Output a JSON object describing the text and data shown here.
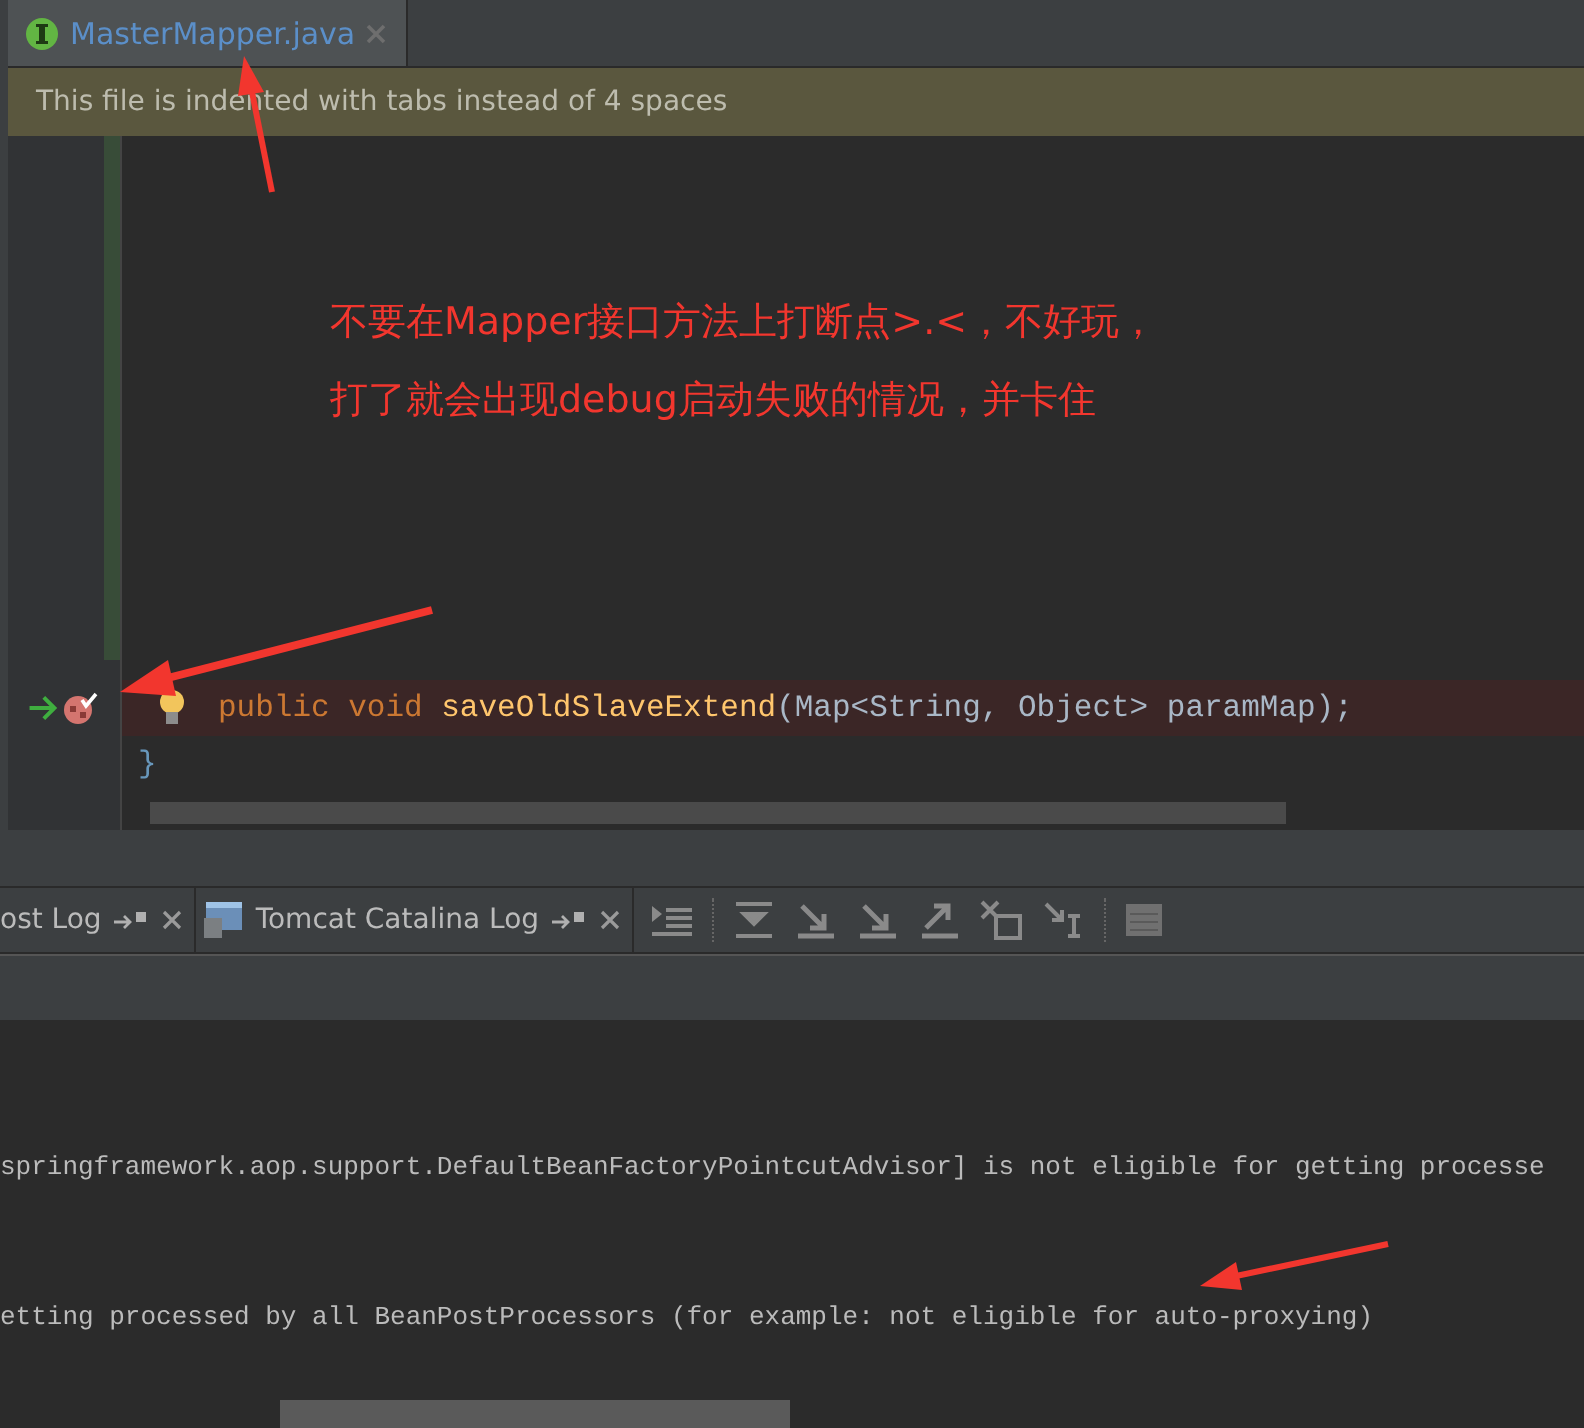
{
  "editor_tabs": [
    {
      "label": "MasterMapper.java",
      "selected": true
    }
  ],
  "notification": {
    "text": "This file is indented with tabs instead of 4 spaces"
  },
  "annotation": {
    "lines": [
      "不要在Mapper接口方法上打断点>.<，不好玩，",
      "打了就会出现debug启动失败的情况，并卡住"
    ]
  },
  "code_lines": [
    {
      "kind": "breakpoint",
      "tokens": [
        {
          "kind": "keyword",
          "text": "public void "
        },
        {
          "kind": "method",
          "text": "saveOldSlaveExtend"
        },
        {
          "kind": "plain",
          "text": "(Map<String, Object> paramMap);"
        }
      ]
    },
    {
      "kind": "brace",
      "tokens": [
        {
          "kind": "brace",
          "text": "}"
        }
      ]
    }
  ],
  "panel_tabs": [
    {
      "label": "ost Log",
      "selected": false,
      "icon": false
    },
    {
      "label": "Tomcat Catalina Log",
      "selected": false,
      "icon": true
    }
  ],
  "console_lines": [
    "springframework.aop.support.DefaultBeanFactoryPointcutAdvisor] is not eligible for getting processe",
    "etting processed by all BeanPostProcessors (for example: not eligible for auto-proxying)"
  ]
}
